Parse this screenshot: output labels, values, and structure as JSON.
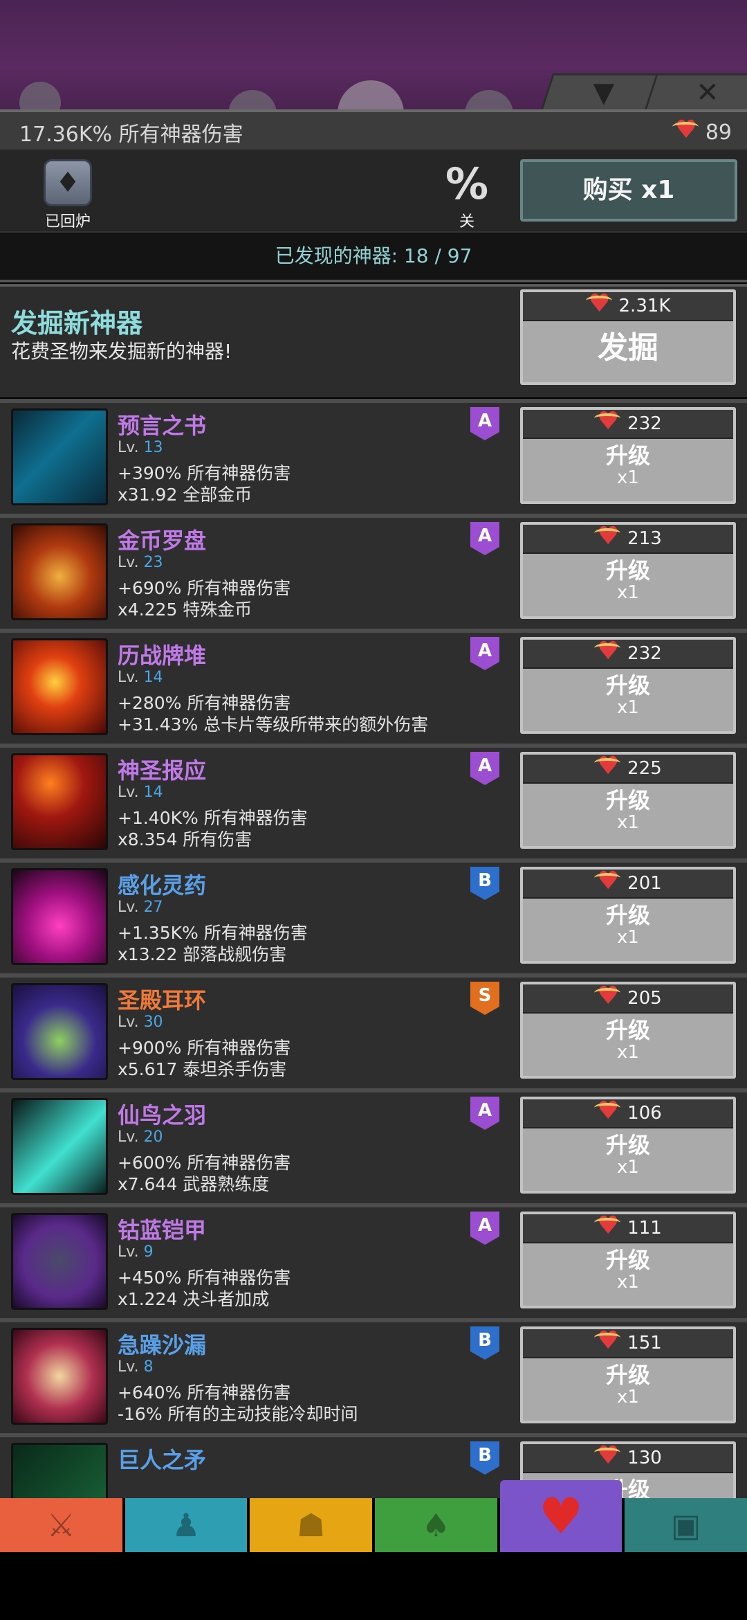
{
  "summary": {
    "damage_text": "17.36K% 所有神器伤害",
    "relics": "89"
  },
  "header": {
    "smelt_label": "已回炉",
    "percent_symbol": "%",
    "percent_label": "关",
    "buy_label": "购买 x1"
  },
  "discovered": "已发现的神器: 18 / 97",
  "dig": {
    "title": "发掘新神器",
    "desc": "花费圣物来发掘新的神器!",
    "cost": "2.31K",
    "button": "发掘"
  },
  "upgrade_label": "升级",
  "upgrade_mult": "x1",
  "artifacts": [
    {
      "name": "预言之书",
      "level": "13",
      "stat1": "+390% 所有神器伤害",
      "stat2": "x31.92 全部金币",
      "tier": "A",
      "cost": "232",
      "name_color": "#c07ae8",
      "tier_color": "#9b4fd0",
      "art": "linear-gradient(135deg,#0a2a3a,#0f6f8f 45%,#0a2a3a)"
    },
    {
      "name": "金币罗盘",
      "level": "23",
      "stat1": "+690% 所有神器伤害",
      "stat2": "x4.225 特殊金币",
      "tier": "A",
      "cost": "213",
      "name_color": "#c07ae8",
      "tier_color": "#9b4fd0",
      "art": "radial-gradient(circle at 50% 55%,#f0b040,#b03a10 45%,#3a0c05)"
    },
    {
      "name": "历战牌堆",
      "level": "14",
      "stat1": "+280% 所有神器伤害",
      "stat2": "+31.43% 总卡片等级所带来的额外伤害",
      "tier": "A",
      "cost": "232",
      "name_color": "#c07ae8",
      "tier_color": "#9b4fd0",
      "art": "radial-gradient(circle at 45% 45%,#ffd040,#e04010 35%,#4a0808)"
    },
    {
      "name": "神圣报应",
      "level": "14",
      "stat1": "+1.40K% 所有神器伤害",
      "stat2": "x8.354 所有伤害",
      "tier": "A",
      "cost": "225",
      "name_color": "#c07ae8",
      "tier_color": "#9b4fd0",
      "art": "radial-gradient(circle at 40% 30%,#ff8020,#a01810 40%,#2a0606)"
    },
    {
      "name": "感化灵药",
      "level": "27",
      "stat1": "+1.35K% 所有神器伤害",
      "stat2": "x13.22 部落战舰伤害",
      "tier": "B",
      "cost": "201",
      "name_color": "#5aa0e8",
      "tier_color": "#2f6fcc",
      "art": "radial-gradient(circle at 50% 60%,#ff40c0,#a01080 45%,#1a0618)"
    },
    {
      "name": "圣殿耳环",
      "level": "30",
      "stat1": "+900% 所有神器伤害",
      "stat2": "x5.617 泰坦杀手伤害",
      "tier": "S",
      "cost": "205",
      "name_color": "#f07a3a",
      "tier_color": "#e07020",
      "art": "radial-gradient(circle at 50% 60%,#8fd060,#3a2a8a 50%,#1a1040)"
    },
    {
      "name": "仙鸟之羽",
      "level": "20",
      "stat1": "+600% 所有神器伤害",
      "stat2": "x7.644 武器熟练度",
      "tier": "A",
      "cost": "106",
      "name_color": "#c07ae8",
      "tier_color": "#9b4fd0",
      "art": "linear-gradient(135deg,#0a1a1a,#40e0d0 55%,#0a2020)"
    },
    {
      "name": "钴蓝铠甲",
      "level": "9",
      "stat1": "+450% 所有神器伤害",
      "stat2": "x1.224 决斗者加成",
      "tier": "A",
      "cost": "111",
      "name_color": "#c07ae8",
      "tier_color": "#9b4fd0",
      "art": "radial-gradient(circle at 50% 50%,#4a4a6a,#5a2a8a 55%,#1a0a2a)"
    },
    {
      "name": "急躁沙漏",
      "level": "8",
      "stat1": "+640% 所有神器伤害",
      "stat2": "-16% 所有的主动技能冷却时间",
      "tier": "B",
      "cost": "151",
      "name_color": "#5aa0e8",
      "tier_color": "#2f6fcc",
      "art": "radial-gradient(circle at 50% 50%,#f0d8a0,#b03050 50%,#3a0818)"
    },
    {
      "name": "巨人之矛",
      "level": "",
      "stat1": "",
      "stat2": "",
      "tier": "B",
      "cost": "130",
      "name_color": "#5aa0e8",
      "tier_color": "#2f6fcc",
      "art": "linear-gradient(135deg,#0a2a1a,#1a6a3a)"
    }
  ],
  "nav": [
    {
      "icon": "sword-icon",
      "glyph": "⚔",
      "color": "#e9603e"
    },
    {
      "icon": "helmet-icon",
      "glyph": "♟",
      "color": "#2e9fb2"
    },
    {
      "icon": "shirt-icon",
      "glyph": "☗",
      "color": "#e6a614"
    },
    {
      "icon": "pet-icon",
      "glyph": "♠",
      "color": "#3f9f3f"
    },
    {
      "icon": "artifact-heart-icon",
      "glyph": "♥",
      "color": "#7a54c8"
    },
    {
      "icon": "chest-icon",
      "glyph": "▣",
      "color": "#2f7f7f"
    }
  ]
}
